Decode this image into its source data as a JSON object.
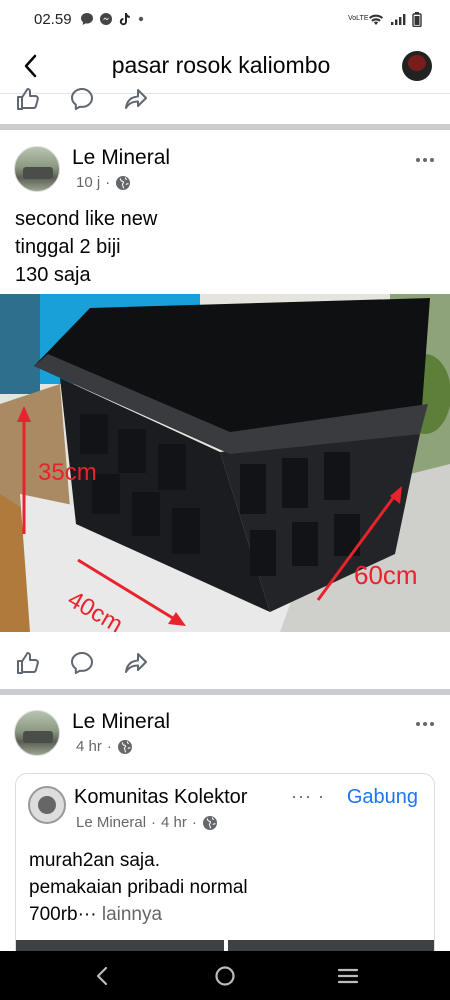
{
  "status_bar": {
    "time": "02.59",
    "icons": [
      "chat-bubble-icon",
      "messenger-icon",
      "tiktok-icon",
      "dot-icon"
    ],
    "right_icons": [
      "volte-icon",
      "wifi-icon",
      "signal-icon",
      "battery-icon"
    ],
    "volte_label": "VoLTE"
  },
  "header": {
    "title": "pasar rosok kaliombo",
    "back_icon": "back-arrow-icon"
  },
  "actions": {
    "like_icon": "like-icon",
    "comment_icon": "comment-icon",
    "share_icon": "share-icon"
  },
  "posts": [
    {
      "author": "Le Mineral",
      "time": "10 j",
      "separator": "·",
      "privacy_icon": "globe-icon",
      "text_lines": [
        "second like new",
        "tinggal 2 biji",
        "130 saja"
      ],
      "photo": {
        "description_labels": [
          "35cm",
          "40cm",
          "60cm"
        ]
      }
    },
    {
      "author": "Le Mineral",
      "time": "4 hr",
      "separator": "·",
      "privacy_icon": "globe-icon",
      "shared": {
        "group_name": "Komunitas Kolektor",
        "group_dots": "··· ·",
        "join_label": "Gabung",
        "author": "Le Mineral",
        "time": "4 hr",
        "separator": "·",
        "text_lines": [
          "murah2an saja.",
          "pemakaian pribadi normal"
        ],
        "text_last": "700rb···",
        "see_more": "lainnya"
      }
    }
  ],
  "colors": {
    "link_blue": "#1877f2",
    "meta_gray": "#65676b",
    "divider_gray": "#c9ccd1",
    "annotation_red": "#e8232c"
  }
}
